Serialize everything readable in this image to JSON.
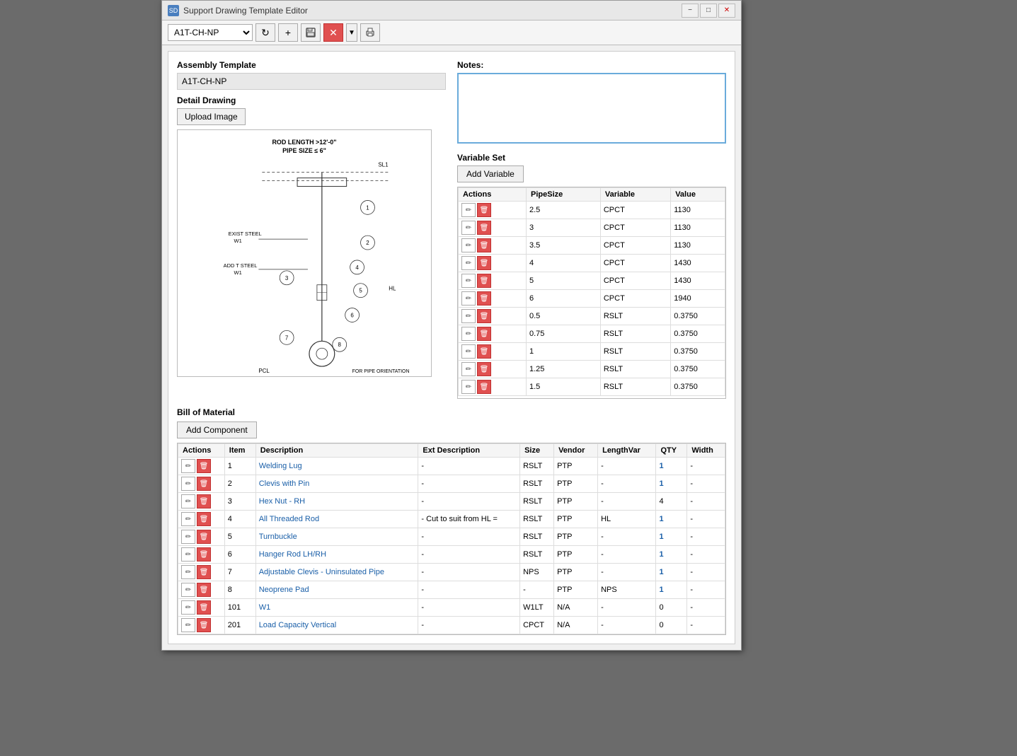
{
  "window": {
    "title": "Support Drawing Template Editor",
    "icon": "SD"
  },
  "toolbar": {
    "template_value": "A1T-CH-NP",
    "buttons": [
      "refresh",
      "add",
      "save",
      "cancel",
      "dropdown",
      "print"
    ]
  },
  "assembly": {
    "label": "Assembly Template",
    "name": "A1T-CH-NP",
    "detail_drawing_label": "Detail Drawing",
    "upload_btn_label": "Upload Image"
  },
  "notes": {
    "label": "Notes:",
    "value": ""
  },
  "variable_set": {
    "label": "Variable Set",
    "add_btn_label": "Add Variable",
    "columns": [
      "Actions",
      "PipeSize",
      "Variable",
      "Value"
    ],
    "rows": [
      {
        "pipesize": "2.5",
        "variable": "CPCT",
        "value": "1130"
      },
      {
        "pipesize": "3",
        "variable": "CPCT",
        "value": "1130"
      },
      {
        "pipesize": "3.5",
        "variable": "CPCT",
        "value": "1130"
      },
      {
        "pipesize": "4",
        "variable": "CPCT",
        "value": "1430"
      },
      {
        "pipesize": "5",
        "variable": "CPCT",
        "value": "1430"
      },
      {
        "pipesize": "6",
        "variable": "CPCT",
        "value": "1940"
      },
      {
        "pipesize": "0.5",
        "variable": "RSLT",
        "value": "0.3750"
      },
      {
        "pipesize": "0.75",
        "variable": "RSLT",
        "value": "0.3750"
      },
      {
        "pipesize": "1",
        "variable": "RSLT",
        "value": "0.3750"
      },
      {
        "pipesize": "1.25",
        "variable": "RSLT",
        "value": "0.3750"
      },
      {
        "pipesize": "1.5",
        "variable": "RSLT",
        "value": "0.3750"
      }
    ]
  },
  "bom": {
    "label": "Bill of Material",
    "add_btn_label": "Add Component",
    "columns": [
      "Actions",
      "Item",
      "Description",
      "Ext Description",
      "Size",
      "Vendor",
      "LengthVar",
      "QTY",
      "Width"
    ],
    "rows": [
      {
        "item": "1",
        "description": "Welding Lug",
        "ext_desc": "-",
        "size": "RSLT",
        "vendor": "PTP",
        "lengthvar": "-",
        "qty": "1",
        "width": "-"
      },
      {
        "item": "2",
        "description": "Clevis with Pin",
        "ext_desc": "-",
        "size": "RSLT",
        "vendor": "PTP",
        "lengthvar": "-",
        "qty": "1",
        "width": "-"
      },
      {
        "item": "3",
        "description": "Hex Nut - RH",
        "ext_desc": "-",
        "size": "RSLT",
        "vendor": "PTP",
        "lengthvar": "-",
        "qty": "4",
        "width": "-"
      },
      {
        "item": "4",
        "description": "All Threaded Rod",
        "ext_desc": "- Cut to suit from HL =",
        "size": "RSLT",
        "vendor": "PTP",
        "lengthvar": "HL",
        "qty": "1",
        "width": "-"
      },
      {
        "item": "5",
        "description": "Turnbuckle",
        "ext_desc": "-",
        "size": "RSLT",
        "vendor": "PTP",
        "lengthvar": "-",
        "qty": "1",
        "width": "-"
      },
      {
        "item": "6",
        "description": "Hanger Rod LH/RH",
        "ext_desc": "-",
        "size": "RSLT",
        "vendor": "PTP",
        "lengthvar": "-",
        "qty": "1",
        "width": "-"
      },
      {
        "item": "7",
        "description": "Adjustable Clevis - Uninsulated Pipe",
        "ext_desc": "-",
        "size": "NPS",
        "vendor": "PTP",
        "lengthvar": "-",
        "qty": "1",
        "width": "-"
      },
      {
        "item": "8",
        "description": "Neoprene Pad",
        "ext_desc": "-",
        "size": "-",
        "vendor": "PTP",
        "lengthvar": "NPS",
        "qty": "1",
        "width": "-"
      },
      {
        "item": "101",
        "description": "W1",
        "ext_desc": "-",
        "size": "W1LT",
        "vendor": "N/A",
        "lengthvar": "-",
        "qty": "0",
        "width": "-"
      },
      {
        "item": "201",
        "description": "Load Capacity Vertical",
        "ext_desc": "-",
        "size": "CPCT",
        "vendor": "N/A",
        "lengthvar": "-",
        "qty": "0",
        "width": "-"
      }
    ]
  },
  "drawing": {
    "title1": "ROD LENGTH >12'-0\"",
    "title2": "PIPE SIZE ≤ 6\""
  }
}
